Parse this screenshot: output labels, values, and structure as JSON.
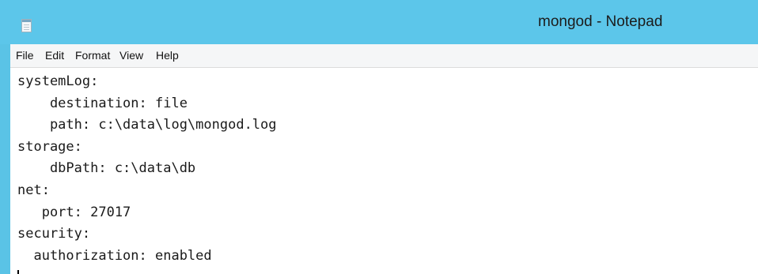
{
  "window": {
    "title": "mongod - Notepad",
    "app_icon": "notepad-icon",
    "titlebar_color": "#5cc6ea"
  },
  "menubar": {
    "items": [
      {
        "label": "File"
      },
      {
        "label": "Edit"
      },
      {
        "label": "Format"
      },
      {
        "label": "View"
      },
      {
        "label": "Help"
      }
    ]
  },
  "editor": {
    "lines": [
      "systemLog:",
      "    destination: file",
      "    path: c:\\data\\log\\mongod.log",
      "storage:",
      "    dbPath: c:\\data\\db",
      "net:",
      "   port: 27017",
      "security:",
      "  authorization: enabled"
    ]
  }
}
